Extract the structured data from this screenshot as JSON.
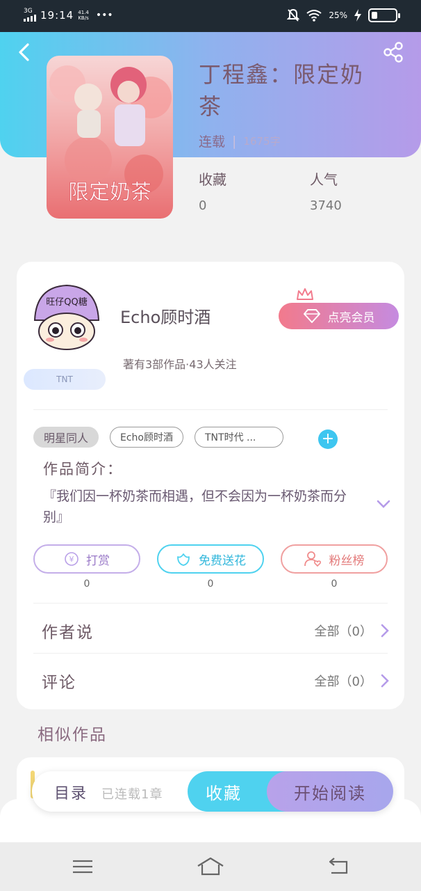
{
  "status_bar": {
    "network": "3G",
    "time": "19:14",
    "speed_value": "41.4",
    "speed_unit": "KB/s",
    "more": "•••",
    "battery": "25%",
    "battery_level": 0.25
  },
  "book": {
    "title": "丁程鑫：限定奶茶",
    "status": "连载",
    "word_count": "1675字",
    "favorites_label": "收藏",
    "favorites_value": "0",
    "popularity_label": "人气",
    "popularity_value": "3740",
    "cover_text": "限定奶茶"
  },
  "author": {
    "name": "Echo顾时酒",
    "stats": "著有3部作品·43人关注",
    "fan_badge": "TNT",
    "avatar_text": "旺仔QQ糖",
    "vip_label": "点亮会员"
  },
  "tags": [
    "明星同人",
    "Echo顾时酒",
    "TNT时代 ..."
  ],
  "intro": {
    "label": "作品简介：",
    "text": "『我们因一杯奶茶而相遇，但不会因为一杯奶茶而分别』"
  },
  "actions": [
    {
      "label": "打赏",
      "count": "0",
      "color": "#b9a0e8"
    },
    {
      "label": "免费送花",
      "count": "0",
      "color": "#4fd2ef"
    },
    {
      "label": "粉丝榜",
      "count": "0",
      "color": "#f08c8c"
    }
  ],
  "rows": {
    "author_says": {
      "label": "作者说",
      "value": "全部（0）"
    },
    "comments": {
      "label": "评论",
      "value": "全部（0）"
    }
  },
  "similar": {
    "title": "相似作品"
  },
  "bottom_bar": {
    "toc_label": "目录",
    "toc_status": "已连载1章",
    "collect_label": "收藏",
    "read_label": "开始阅读"
  },
  "colors": {
    "accent_cyan": "#4fd2ef",
    "accent_purple": "#b59be9",
    "accent_pink": "#f27a8c"
  }
}
